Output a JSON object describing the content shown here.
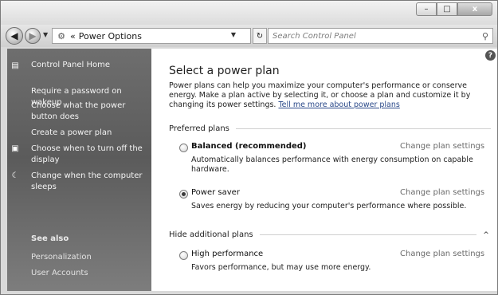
{
  "window": {
    "caption_buttons": {
      "minimize": "–",
      "maximize": "□",
      "close": "x"
    }
  },
  "address_bar": {
    "back_icon": "back-arrow-icon",
    "forward_icon": "forward-arrow-icon",
    "breadcrumb_sep": "«",
    "path": "Power Options",
    "refresh_glyph": "↻"
  },
  "search": {
    "placeholder": "Search Control Panel"
  },
  "sidebar": {
    "home": "Control Panel Home",
    "tasks": [
      "Require a password on wakeup",
      "Choose what the power button does",
      "Create a power plan",
      "Choose when to turn off the display",
      "Change when the computer sleeps"
    ],
    "see_also": "See also",
    "see_also_items": [
      "Personalization",
      "User Accounts"
    ]
  },
  "main": {
    "help_glyph": "?",
    "title": "Select a power plan",
    "intro": "Power plans can help you maximize your computer's performance or conserve energy. Make a plan active by selecting it, or choose a plan and customize it by changing its power settings.",
    "intro_link": "Tell me more about power plans",
    "preferred_label": "Preferred plans",
    "additional_label": "Hide additional plans",
    "collapse_glyph": "^",
    "change_label": "Change plan settings",
    "plans": [
      {
        "name": "Balanced (recommended)",
        "desc": "Automatically balances performance with energy consumption on capable hardware.",
        "selected": false
      },
      {
        "name": "Power saver",
        "desc": "Saves energy by reducing your computer's performance where possible.",
        "selected": true
      },
      {
        "name": "High performance",
        "desc": "Favors performance, but may use more energy.",
        "selected": false
      }
    ]
  }
}
